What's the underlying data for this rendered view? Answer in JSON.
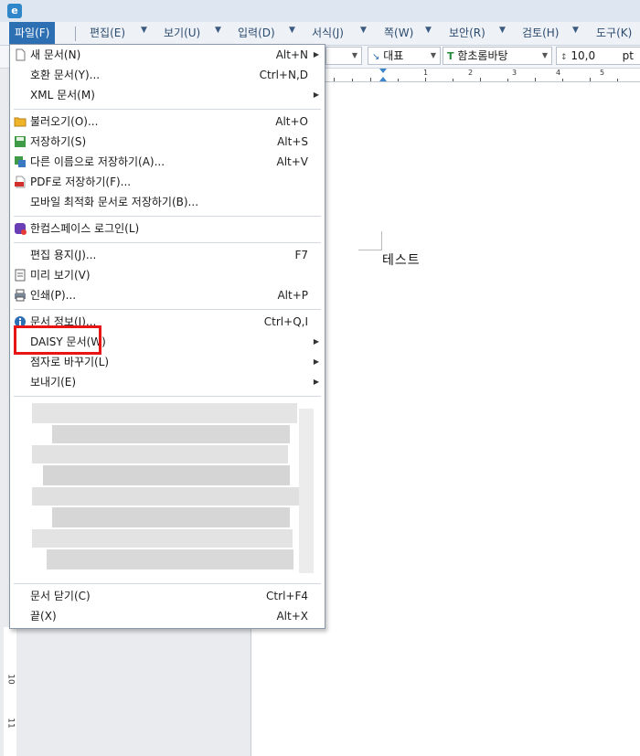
{
  "menubar": {
    "items": [
      {
        "label": "파일(F)"
      },
      {
        "label": "편집(E)"
      },
      {
        "label": "보기(U)"
      },
      {
        "label": "입력(D)"
      },
      {
        "label": "서식(J)"
      },
      {
        "label": "쪽(W)"
      },
      {
        "label": "보안(R)"
      },
      {
        "label": "검토(H)"
      },
      {
        "label": "도구(K)"
      }
    ]
  },
  "toolbar": {
    "style_value": "대표",
    "font_value": "함초롬바탕",
    "size_value": "10,0",
    "size_unit": "pt"
  },
  "ruler": {
    "labels": [
      "1",
      "2",
      "3",
      "4",
      "5"
    ],
    "v_labels": [
      "10",
      "11"
    ]
  },
  "document": {
    "text": "테스트"
  },
  "file_menu": {
    "items": [
      {
        "label": "새 문서(N)",
        "shortcut": "Alt+N",
        "submenu": true
      },
      {
        "label": "호환 문서(Y)...",
        "shortcut": "Ctrl+N,D"
      },
      {
        "label": "XML 문서(M)",
        "submenu": true
      },
      {
        "label": "불러오기(O)...",
        "shortcut": "Alt+O"
      },
      {
        "label": "저장하기(S)",
        "shortcut": "Alt+S"
      },
      {
        "label": "다른 이름으로 저장하기(A)...",
        "shortcut": "Alt+V"
      },
      {
        "label": "PDF로 저장하기(F)..."
      },
      {
        "label": "모바일 최적화 문서로 저장하기(B)..."
      },
      {
        "label": "한컴스페이스 로그인(L)"
      },
      {
        "label": "편집 용지(J)...",
        "shortcut": "F7"
      },
      {
        "label": "미리 보기(V)"
      },
      {
        "label": "인쇄(P)...",
        "shortcut": "Alt+P"
      },
      {
        "label": "문서 정보(I)...",
        "shortcut": "Ctrl+Q,I"
      },
      {
        "label": "DAISY 문서(W)",
        "submenu": true
      },
      {
        "label": "점자로 바꾸기(L)",
        "submenu": true
      },
      {
        "label": "보내기(E)",
        "submenu": true
      },
      {
        "label": "문서 닫기(C)",
        "shortcut": "Ctrl+F4"
      },
      {
        "label": "끝(X)",
        "shortcut": "Alt+X"
      }
    ]
  }
}
